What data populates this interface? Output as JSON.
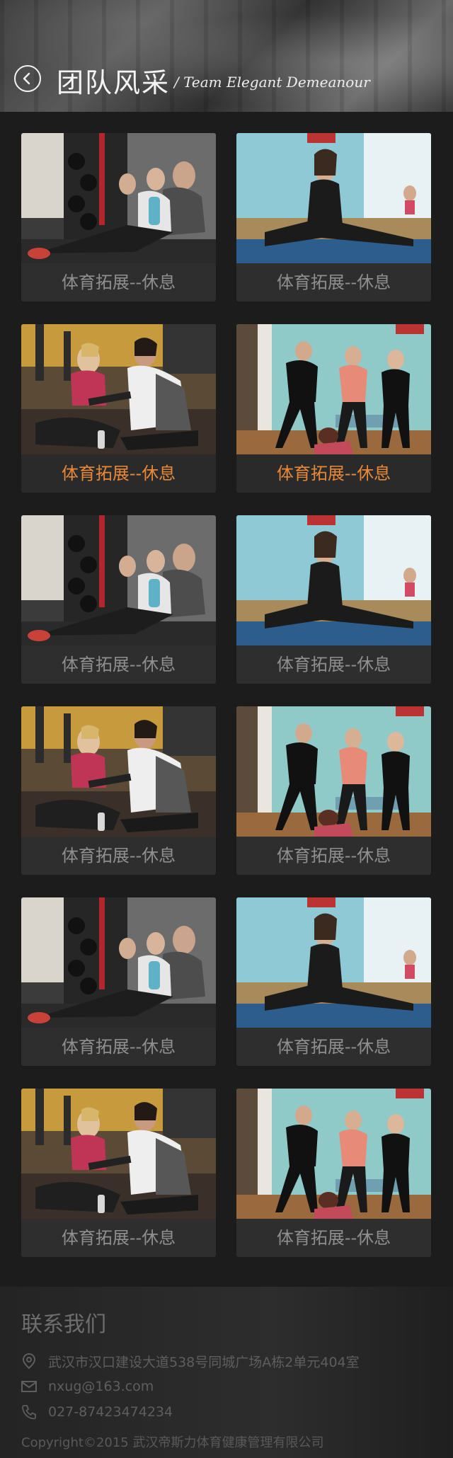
{
  "header": {
    "title": "团队风采",
    "subtitle": "/ Team Elegant Demeanour",
    "back_icon": "chevron-left-icon"
  },
  "gallery": {
    "items": [
      {
        "caption": "体育拓展--休息",
        "photo": "gym-rest-photo",
        "active": false
      },
      {
        "caption": "体育拓展--休息",
        "photo": "stretch-split-photo",
        "active": false
      },
      {
        "caption": "体育拓展--休息",
        "photo": "tablet-talk-photo",
        "active": true
      },
      {
        "caption": "体育拓展--休息",
        "photo": "group-stretch-photo",
        "active": true
      },
      {
        "caption": "体育拓展--休息",
        "photo": "gym-rest-photo",
        "active": false
      },
      {
        "caption": "体育拓展--休息",
        "photo": "stretch-split-photo",
        "active": false
      },
      {
        "caption": "体育拓展--休息",
        "photo": "tablet-talk-photo",
        "active": false
      },
      {
        "caption": "体育拓展--休息",
        "photo": "group-stretch-photo",
        "active": false
      },
      {
        "caption": "体育拓展--休息",
        "photo": "gym-rest-photo",
        "active": false
      },
      {
        "caption": "体育拓展--休息",
        "photo": "stretch-split-photo",
        "active": false
      },
      {
        "caption": "体育拓展--休息",
        "photo": "tablet-talk-photo",
        "active": false
      },
      {
        "caption": "体育拓展--休息",
        "photo": "group-stretch-photo",
        "active": false
      }
    ]
  },
  "footer": {
    "title": "联系我们",
    "address": "武汉市汉口建设大道538号同城广场A栋2单元404室",
    "email": "nxug@163.com",
    "phone": "027-87423474234",
    "copyright": "Copyright©2015 武汉帝斯力体育健康管理有限公司"
  },
  "colors": {
    "caption_default": "#8f8f8f",
    "caption_active": "#e8893a",
    "background": "#1c1c1c"
  }
}
